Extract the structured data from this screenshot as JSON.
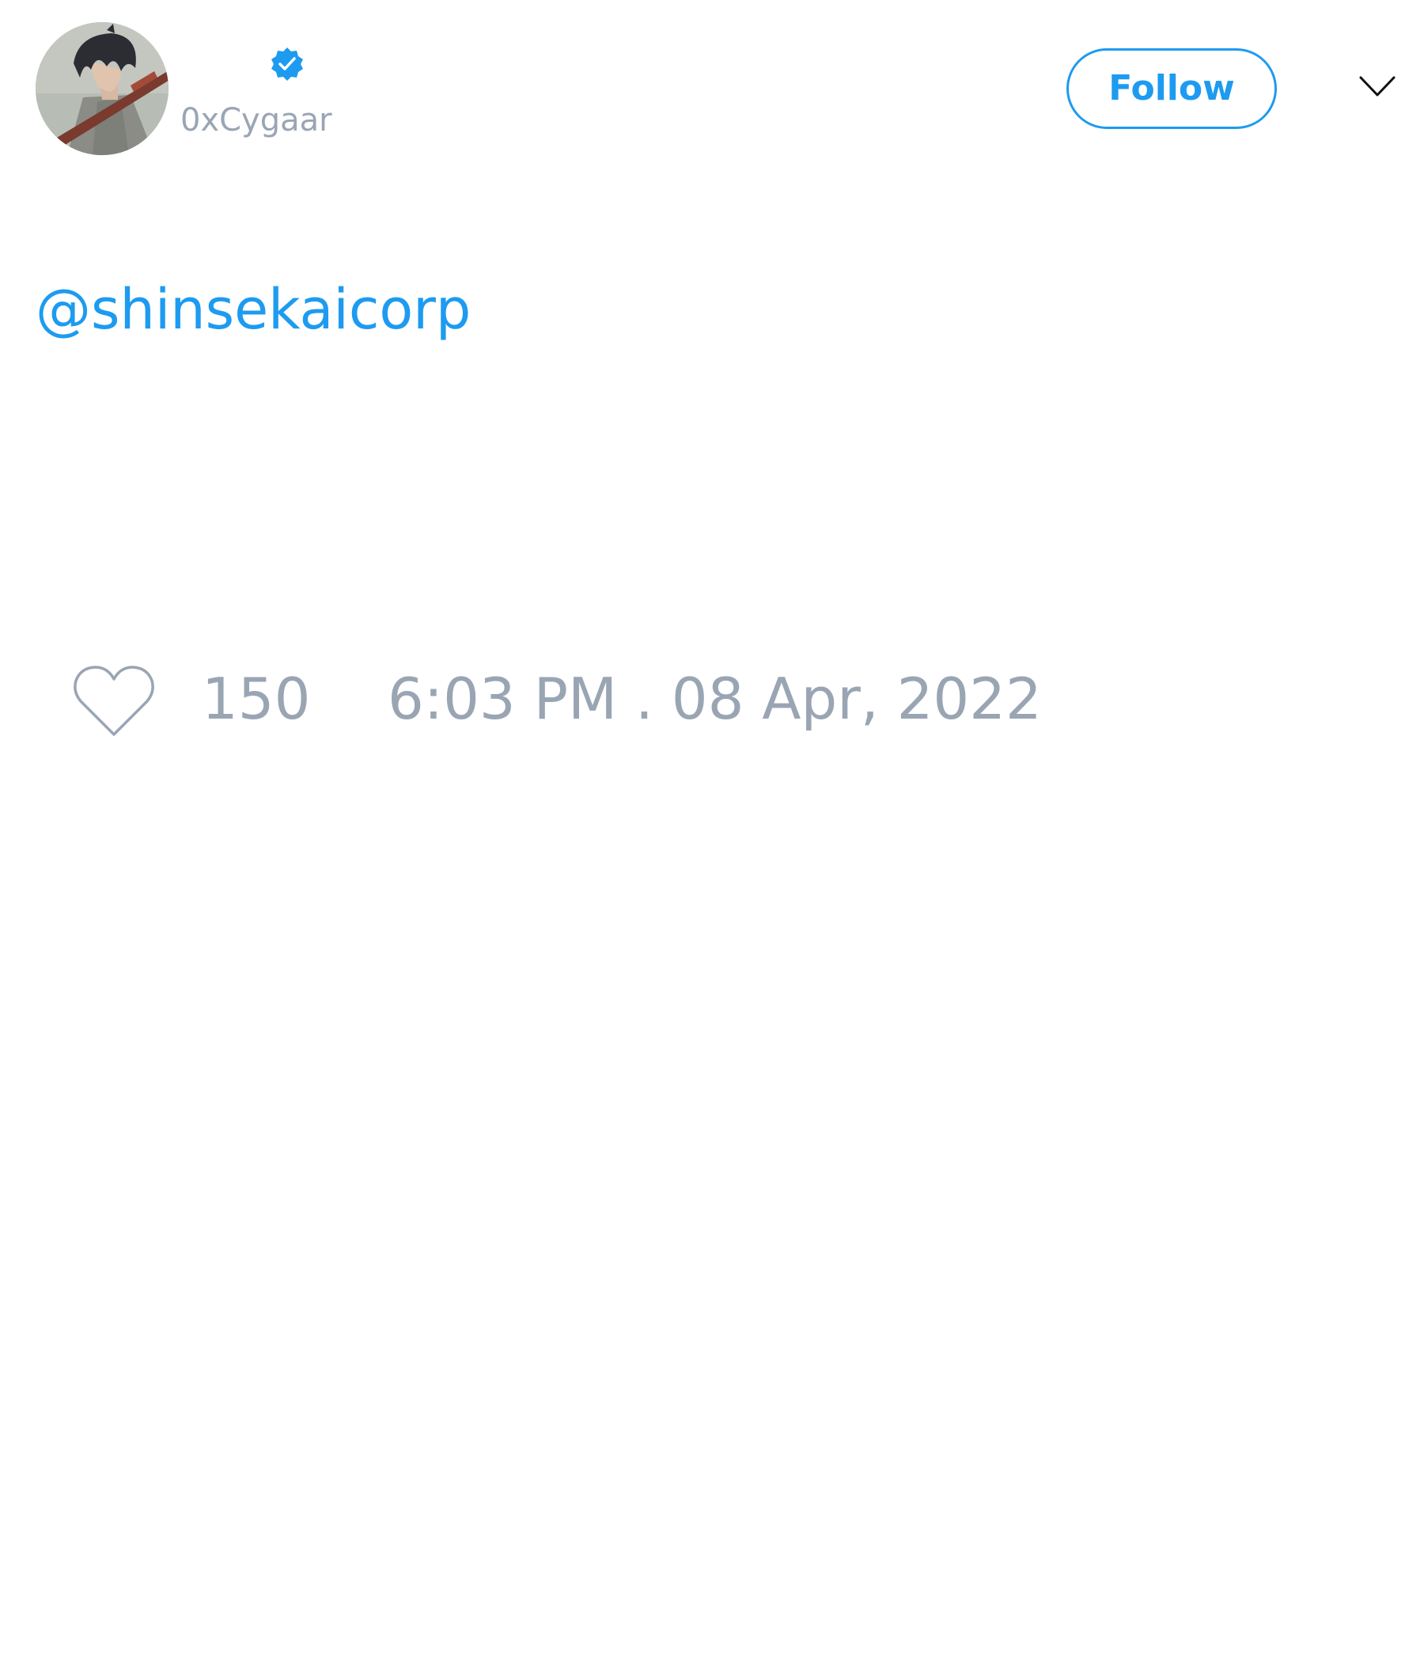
{
  "tweet": {
    "author": {
      "handle": "0xCygaar",
      "verified": true,
      "avatar_icon": "avatar-image"
    },
    "follow_label": "Follow",
    "menu_icon": "chevron-down-icon",
    "mention": "@shinsekaicorp",
    "likes": {
      "icon": "heart-icon",
      "count": "150"
    },
    "timestamp": "6:03 PM . 08 Apr, 2022"
  },
  "colors": {
    "accent": "#1d9bf0",
    "muted_text": "#9aa5b4",
    "background": "#ffffff"
  }
}
